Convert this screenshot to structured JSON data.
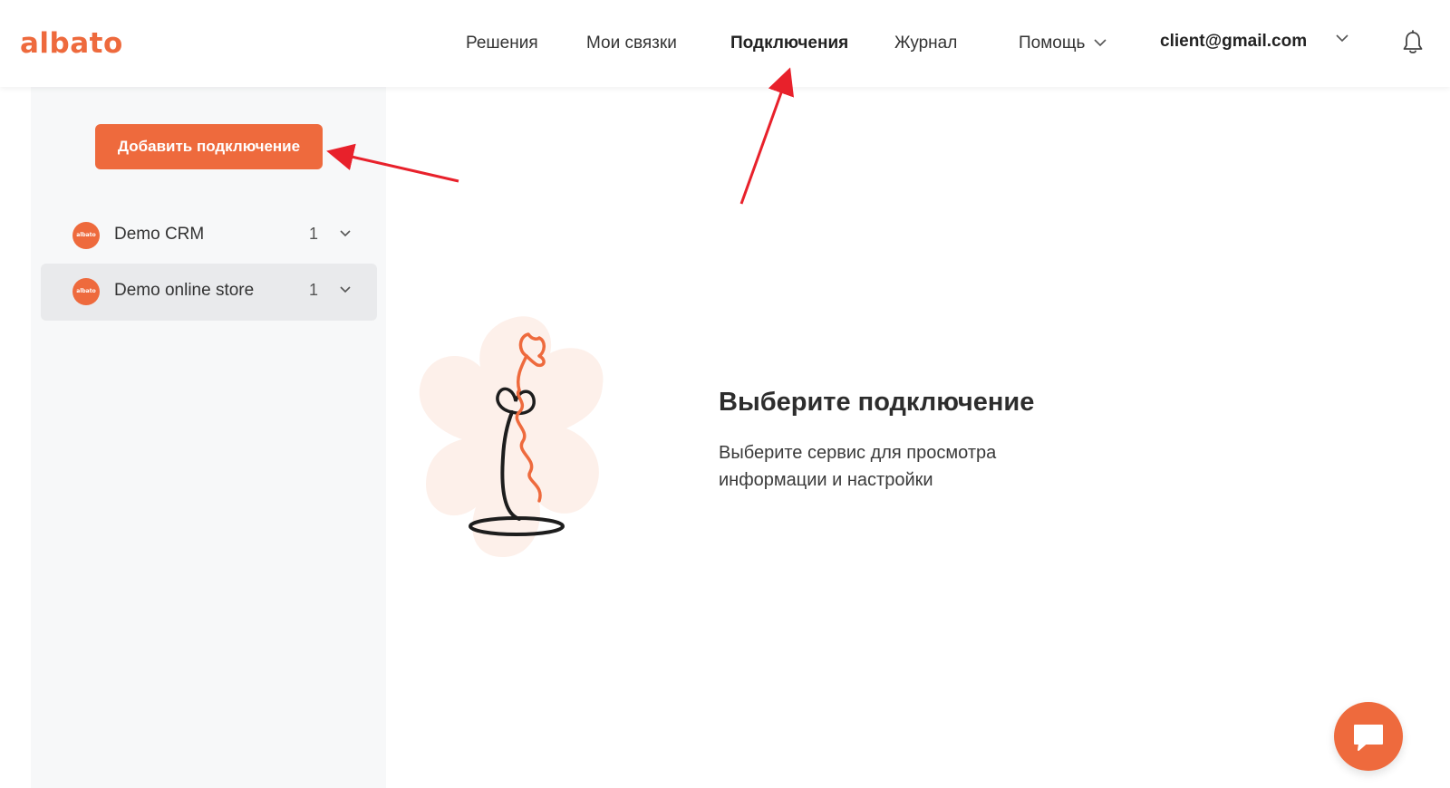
{
  "colors": {
    "brand": "#ee6a3d",
    "arrow": "#e8212b"
  },
  "header": {
    "logo": "albato",
    "nav": [
      {
        "label": "Решения"
      },
      {
        "label": "Мои связки"
      },
      {
        "label": "Подключения",
        "active": true
      },
      {
        "label": "Журнал"
      },
      {
        "label": "Помощь",
        "dropdown": true
      }
    ],
    "user_email": "client@gmail.com",
    "bell_icon": "bell-icon"
  },
  "sidebar": {
    "add_button_label": "Добавить подключение",
    "connections": [
      {
        "name": "Demo CRM",
        "count": "1",
        "avatar_text": "albato",
        "selected": false
      },
      {
        "name": "Demo online store",
        "count": "1",
        "avatar_text": "albato",
        "selected": true
      }
    ]
  },
  "main": {
    "empty_title": "Выберите подключение",
    "empty_text": "Выберите сервис для просмотра информации и настройки"
  },
  "chat_icon": "chat-icon"
}
